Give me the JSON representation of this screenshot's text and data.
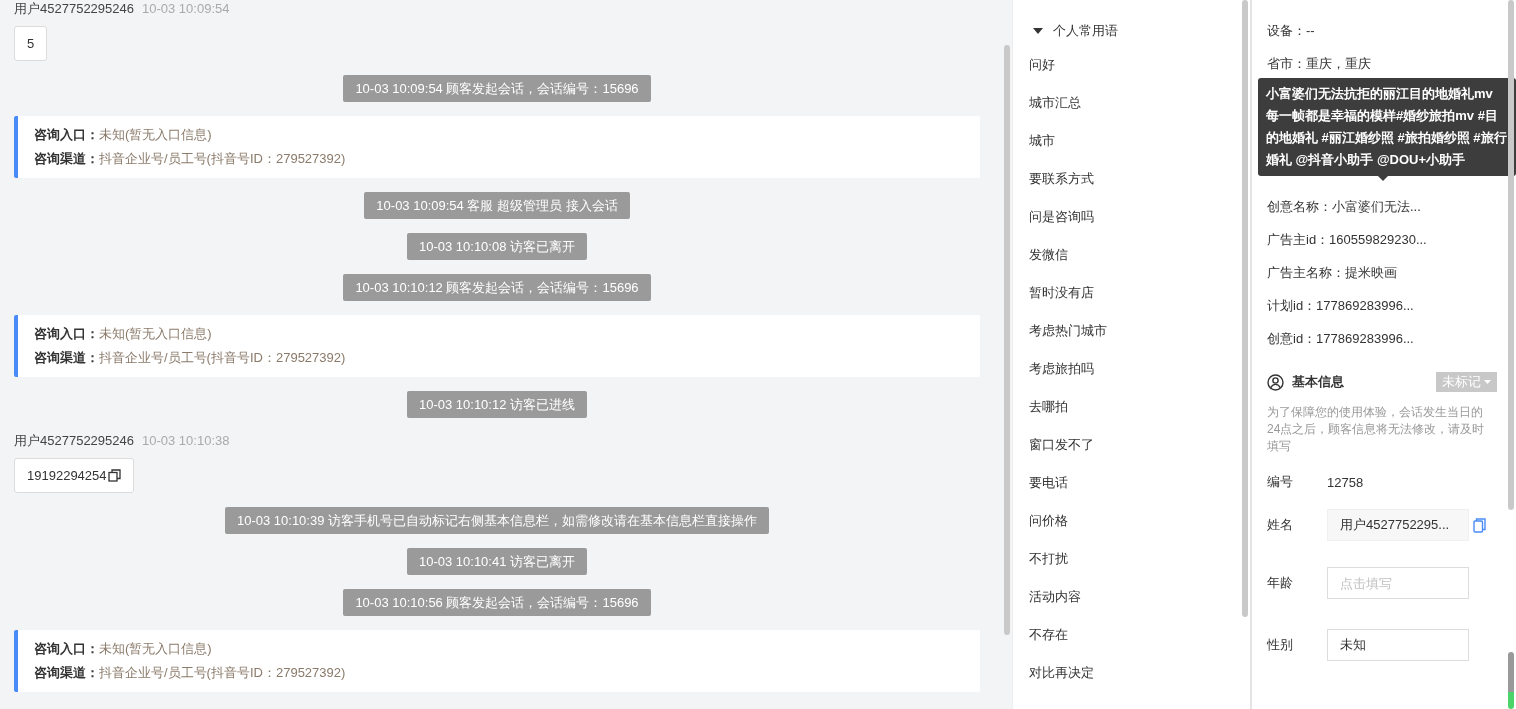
{
  "chat": {
    "messages": [
      {
        "kind": "user",
        "name": "用户4527752295246",
        "time": "10-03 10:09:54",
        "text": "5",
        "copyable": false
      },
      {
        "kind": "system",
        "text": "10-03 10:09:54 顾客发起会话，会话编号：15696"
      },
      {
        "kind": "card",
        "lines": [
          {
            "label": "咨询入口：",
            "value": "未知(暂无入口信息)"
          },
          {
            "label": "咨询渠道：",
            "value": "抖音企业号/员工号(抖音号ID：279527392)"
          }
        ]
      },
      {
        "kind": "system",
        "text": "10-03 10:09:54 客服 超级管理员 接入会话"
      },
      {
        "kind": "system",
        "text": "10-03 10:10:08 访客已离开"
      },
      {
        "kind": "system",
        "text": "10-03 10:10:12 顾客发起会话，会话编号：15696"
      },
      {
        "kind": "card",
        "lines": [
          {
            "label": "咨询入口：",
            "value": "未知(暂无入口信息)"
          },
          {
            "label": "咨询渠道：",
            "value": "抖音企业号/员工号(抖音号ID：279527392)"
          }
        ]
      },
      {
        "kind": "system",
        "text": "10-03 10:10:12 访客已进线"
      },
      {
        "kind": "user",
        "name": "用户4527752295246",
        "time": "10-03 10:10:38",
        "text": "19192294254",
        "copyable": true
      },
      {
        "kind": "system",
        "text": "10-03 10:10:39 访客手机号已自动标记右侧基本信息栏，如需修改请在基本信息栏直接操作"
      },
      {
        "kind": "system",
        "text": "10-03 10:10:41 访客已离开"
      },
      {
        "kind": "system",
        "text": "10-03 10:10:56 顾客发起会话，会话编号：15696"
      },
      {
        "kind": "card",
        "lines": [
          {
            "label": "咨询入口：",
            "value": "未知(暂无入口信息)"
          },
          {
            "label": "咨询渠道：",
            "value": "抖音企业号/员工号(抖音号ID：279527392)"
          }
        ]
      }
    ]
  },
  "phrases": {
    "group": "个人常用语",
    "expanded": true,
    "items": [
      "问好",
      "城市汇总",
      "城市",
      "要联系方式",
      "问是咨询吗",
      "发微信",
      "暂时没有店",
      "考虑热门城市",
      "考虑旅拍吗",
      "去哪拍",
      "窗口发不了",
      "要电话",
      "问价格",
      "不打扰",
      "活动内容",
      "不存在",
      "对比再决定"
    ]
  },
  "visitor": {
    "info_rows": [
      "设备：--",
      "省市：重庆，重庆",
      "创意名称：小富婆们无法...",
      "广告主id：160559829230...",
      "广告主名称：提米映画",
      "计划id：177869283996...",
      "创意id：177869283996..."
    ],
    "tooltip": "小富婆们无法抗拒的丽江目的地婚礼mv 每一帧都是幸福的模样#婚纱旅拍mv #目的地婚礼 #丽江婚纱照 #旅拍婚纱照 #旅行婚礼 @抖音小助手 @DOU+小助手",
    "basic": {
      "title": "基本信息",
      "tag": "未标记",
      "note": "为了保障您的使用体验，会话发生当日的24点之后，顾客信息将无法修改，请及时填写",
      "fields": [
        {
          "kind": "text",
          "label": "编号",
          "value": "12758"
        },
        {
          "kind": "filled",
          "label": "姓名",
          "value": "用户4527752295..."
        },
        {
          "kind": "input",
          "label": "年龄",
          "placeholder": "点击填写"
        },
        {
          "kind": "input",
          "label": "性别",
          "value": "未知"
        }
      ]
    }
  }
}
